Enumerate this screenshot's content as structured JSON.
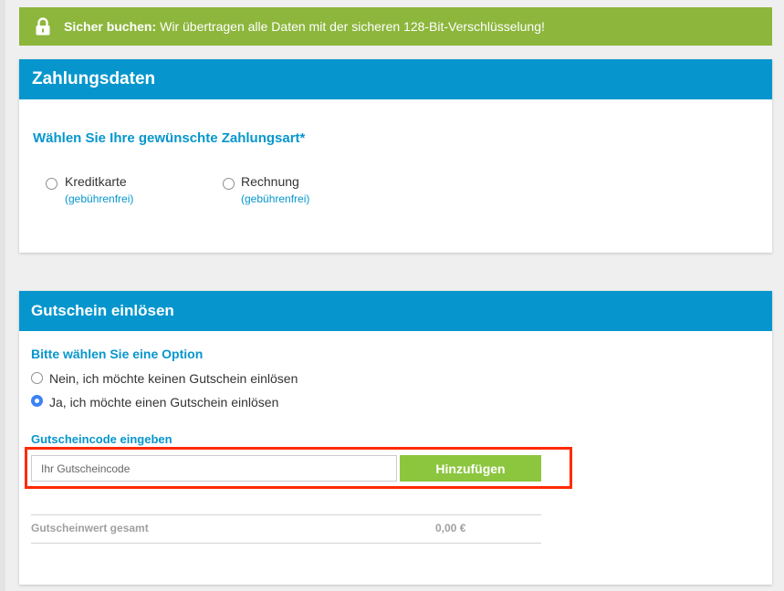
{
  "banner": {
    "bold_text": "Sicher buchen:",
    "text": "Wir übertragen alle Daten mit der sicheren 128-Bit-Verschlüsselung!",
    "icon": "lock-icon",
    "color": "#8cb63c"
  },
  "payment": {
    "title": "Zahlungsdaten",
    "question": "Wählen Sie Ihre gewünschte Zahlungsart*",
    "options": [
      {
        "label": "Kreditkarte",
        "sub": "(gebührenfrei)",
        "selected": false
      },
      {
        "label": "Rechnung",
        "sub": "(gebührenfrei)",
        "selected": false
      }
    ]
  },
  "voucher": {
    "title": "Gutschein einlösen",
    "option_heading": "Bitte wählen Sie eine Option",
    "options": [
      {
        "label": "Nein, ich möchte keinen Gutschein einlösen",
        "selected": false
      },
      {
        "label": "Ja, ich möchte einen Gutschein einlösen",
        "selected": true
      }
    ],
    "code_heading": "Gutscheincode eingeben",
    "input_placeholder": "Ihr Gutscheincode",
    "input_value": "",
    "add_button": "Hinzufügen",
    "total_label": "Gutscheinwert gesamt",
    "total_value": "0,00 €"
  },
  "colors": {
    "header_blue": "#0696cd",
    "button_green": "#8cc63f",
    "highlight_red": "#ff2a00"
  }
}
